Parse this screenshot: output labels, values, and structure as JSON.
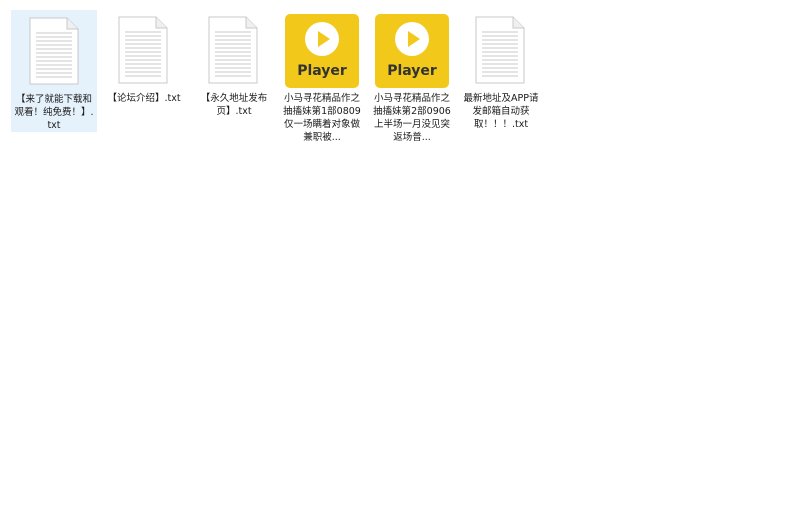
{
  "files": [
    {
      "name": "【来了就能下载和观看！纯免费！】.txt",
      "type": "text",
      "icon": "text-document-icon",
      "selected": true
    },
    {
      "name": "【论坛介绍】.txt",
      "type": "text",
      "icon": "text-document-icon",
      "selected": false
    },
    {
      "name": "【永久地址发布页】.txt",
      "type": "text",
      "icon": "text-document-icon",
      "selected": false
    },
    {
      "name": "小马寻花精品作之抽搐妹第1部0809仅一场瞒着对象做兼职被...",
      "type": "video",
      "icon": "player-icon",
      "icon_label": "Player",
      "selected": false
    },
    {
      "name": "小马寻花精品作之抽搐妹第2部0906上半场一月没见突返场普...",
      "type": "video",
      "icon": "player-icon",
      "icon_label": "Player",
      "selected": false
    },
    {
      "name": "最新地址及APP请发邮箱自动获取！！！.txt",
      "type": "text",
      "icon": "text-document-icon",
      "selected": false
    }
  ],
  "colors": {
    "selection_bg": "#e5f1fb",
    "player_yellow": "#f2c81a"
  }
}
